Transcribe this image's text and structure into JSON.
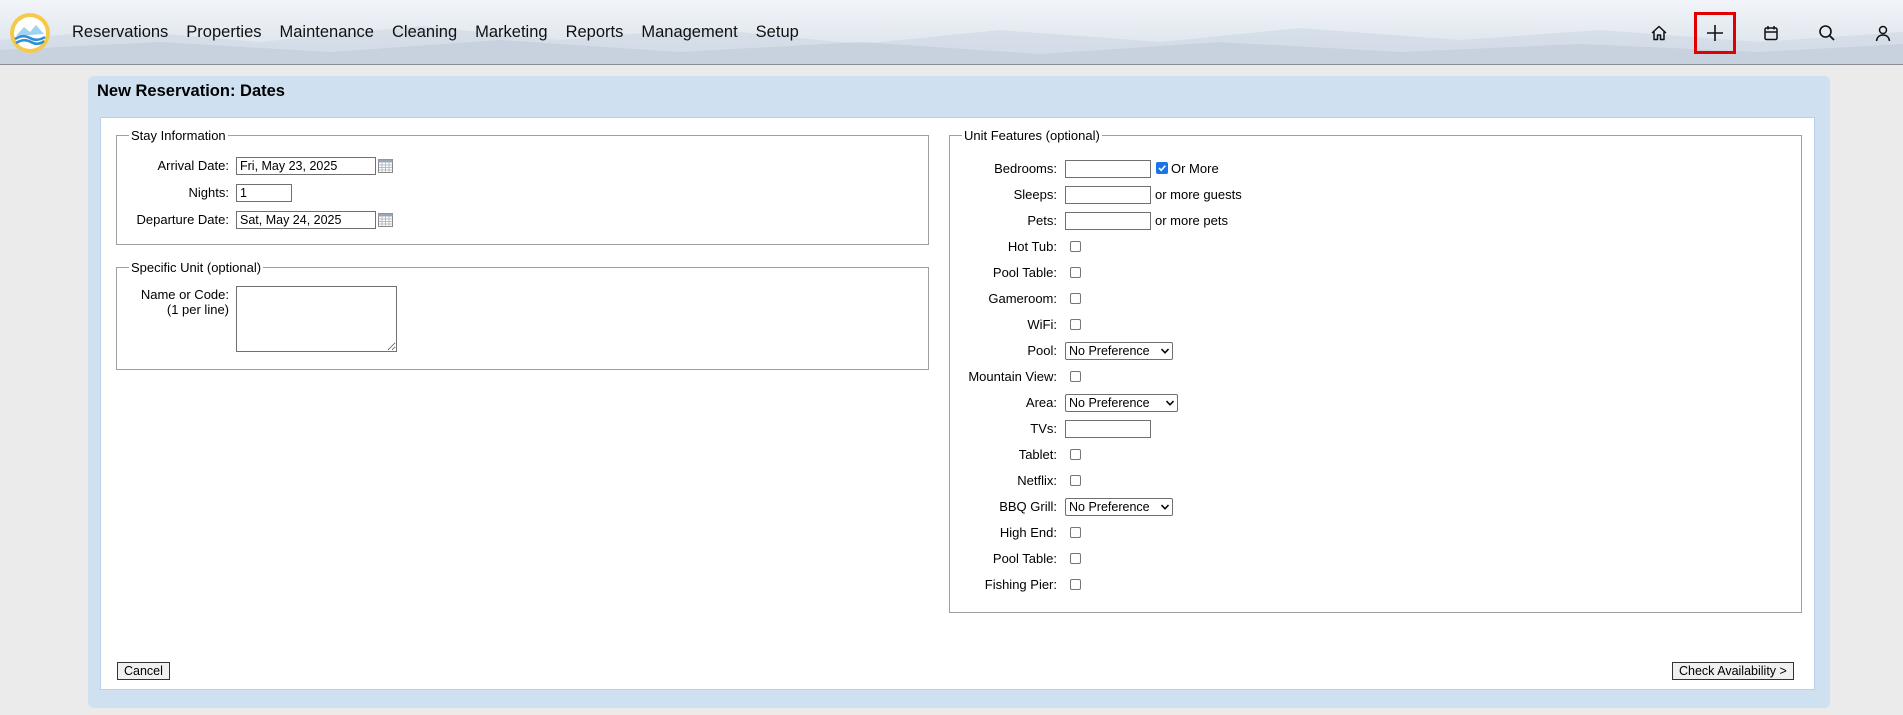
{
  "nav": {
    "items": [
      "Reservations",
      "Properties",
      "Maintenance",
      "Cleaning",
      "Marketing",
      "Reports",
      "Management",
      "Setup"
    ]
  },
  "toolbar": {
    "icons": [
      "home-icon",
      "plus-icon",
      "calendar-icon",
      "search-icon",
      "user-icon"
    ],
    "active": "plus-icon"
  },
  "colors": {
    "accent": "#e00000",
    "panel": "#cfe0f1",
    "checkbox_checked": "#1a73e8"
  },
  "page": {
    "title": "New Reservation: Dates"
  },
  "stay": {
    "legend": "Stay Information",
    "arrival_label": "Arrival Date:",
    "arrival_value": "Fri, May 23, 2025",
    "nights_label": "Nights:",
    "nights_value": "1",
    "departure_label": "Departure Date:",
    "departure_value": "Sat, May 24, 2025"
  },
  "unit": {
    "legend": "Specific Unit (optional)",
    "name_label": "Name or Code:",
    "name_hint": "(1 per line)",
    "name_value": ""
  },
  "features": {
    "legend": "Unit Features (optional)",
    "bedrooms_label": "Bedrooms:",
    "bedrooms_value": "",
    "or_more_label": "Or More",
    "or_more_checked": true,
    "sleeps_label": "Sleeps:",
    "sleeps_value": "",
    "sleeps_suffix": "or more guests",
    "pets_label": "Pets:",
    "pets_value": "",
    "pets_suffix": "or more pets",
    "hot_tub_label": "Hot Tub:",
    "pool_table_label": "Pool Table:",
    "gameroom_label": "Gameroom:",
    "wifi_label": "WiFi:",
    "pool_label": "Pool:",
    "pool_value": "No Preference",
    "mountain_view_label": "Mountain View:",
    "area_label": "Area:",
    "area_value": "No Preference",
    "tvs_label": "TVs:",
    "tvs_value": "",
    "tablet_label": "Tablet:",
    "netflix_label": "Netflix:",
    "bbq_label": "BBQ Grill:",
    "bbq_value": "No Preference",
    "high_end_label": "High End:",
    "pool_table2_label": "Pool Table:",
    "fishing_pier_label": "Fishing Pier:"
  },
  "actions": {
    "cancel": "Cancel",
    "check": "Check Availability >"
  }
}
